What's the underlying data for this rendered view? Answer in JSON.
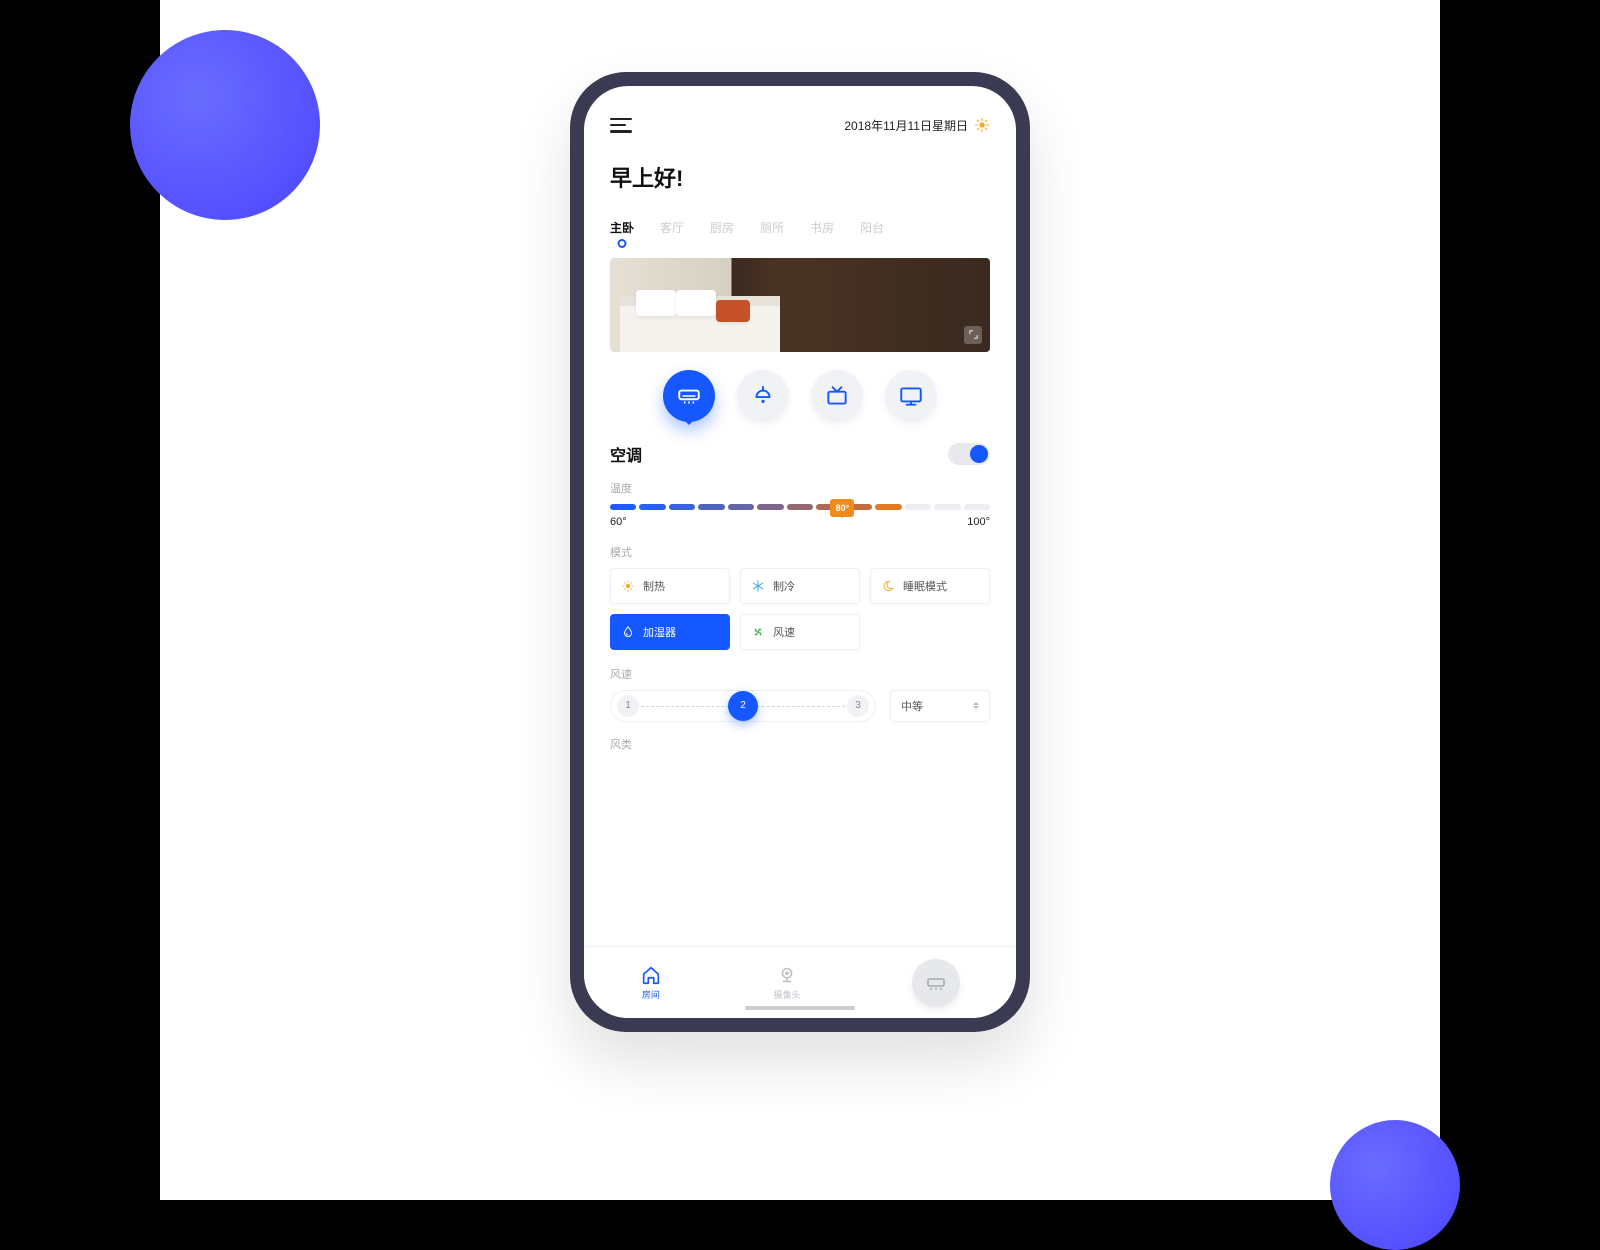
{
  "header": {
    "date": "2018年11月11日星期日"
  },
  "greeting": "早上好!",
  "rooms": {
    "active": 0,
    "items": [
      "主卧",
      "客厅",
      "厨房",
      "厕所",
      "书房",
      "阳台"
    ]
  },
  "devices": {
    "active": 0,
    "items": [
      "ac-icon",
      "light-icon",
      "tv-icon",
      "monitor-icon"
    ]
  },
  "ac": {
    "title": "空调",
    "temp_label": "温度",
    "temp_min": "60°",
    "temp_max": "100°",
    "temp_value": "80°",
    "mode_label": "模式",
    "modes": [
      {
        "label": "制热",
        "icon": "sun",
        "color": "#f5a623"
      },
      {
        "label": "制冷",
        "icon": "snow",
        "color": "#2aa7e6"
      },
      {
        "label": "睡眠模式",
        "icon": "moon",
        "color": "#f5a623"
      },
      {
        "label": "加湿器",
        "icon": "drop",
        "color": "#fff",
        "active": true
      },
      {
        "label": "风速",
        "icon": "fan",
        "color": "#3ab54a"
      }
    ],
    "fan_label": "风速",
    "fan_levels": [
      "1",
      "2",
      "3"
    ],
    "fan_active": 1,
    "fan_select": "中等",
    "wind_type_label": "风类"
  },
  "nav": {
    "items": [
      "房间",
      "摄像头"
    ],
    "active": 0
  },
  "seg_colors": [
    "#1f5bff",
    "#2860f0",
    "#3a62d9",
    "#5063bf",
    "#6665a6",
    "#7d678c",
    "#946973",
    "#ab6b59",
    "#c26d40",
    "#e07a24",
    "#eceef2",
    "#eceef2",
    "#eceef2"
  ]
}
